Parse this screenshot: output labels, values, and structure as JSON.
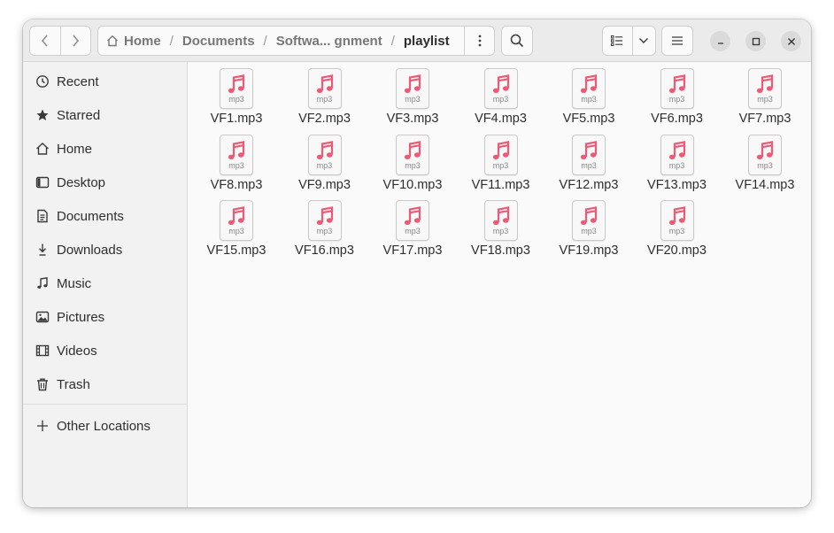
{
  "window": {
    "title": "playlist"
  },
  "headerbar": {
    "back_icon": "chevron-left-icon",
    "forward_icon": "chevron-right-icon",
    "path": [
      "Home",
      "Documents",
      "Softwa... gnment",
      "playlist"
    ],
    "path_separator": "/",
    "more_icon": "vertical-ellipsis-icon",
    "search_icon": "search-icon",
    "view_icon": "list-view-icon",
    "view_dropdown_icon": "chevron-down-icon",
    "menu_icon": "hamburger-icon",
    "minimize_icon": "minimize-icon",
    "maximize_icon": "maximize-icon",
    "close_icon": "close-icon"
  },
  "sidebar": {
    "items": [
      {
        "label": "Recent",
        "icon": "clock-icon"
      },
      {
        "label": "Starred",
        "icon": "star-icon"
      },
      {
        "label": "Home",
        "icon": "home-icon"
      },
      {
        "label": "Desktop",
        "icon": "desktop-icon"
      },
      {
        "label": "Documents",
        "icon": "document-icon"
      },
      {
        "label": "Downloads",
        "icon": "download-icon"
      },
      {
        "label": "Music",
        "icon": "music-note-icon"
      },
      {
        "label": "Pictures",
        "icon": "picture-icon"
      },
      {
        "label": "Videos",
        "icon": "film-icon"
      },
      {
        "label": "Trash",
        "icon": "trash-icon"
      }
    ],
    "other_locations": {
      "label": "Other Locations",
      "icon": "plus-icon"
    }
  },
  "files": [
    {
      "name": "VF1.mp3",
      "ext": "mp3"
    },
    {
      "name": "VF2.mp3",
      "ext": "mp3"
    },
    {
      "name": "VF3.mp3",
      "ext": "mp3"
    },
    {
      "name": "VF4.mp3",
      "ext": "mp3"
    },
    {
      "name": "VF5.mp3",
      "ext": "mp3"
    },
    {
      "name": "VF6.mp3",
      "ext": "mp3"
    },
    {
      "name": "VF7.mp3",
      "ext": "mp3"
    },
    {
      "name": "VF8.mp3",
      "ext": "mp3"
    },
    {
      "name": "VF9.mp3",
      "ext": "mp3"
    },
    {
      "name": "VF10.mp3",
      "ext": "mp3"
    },
    {
      "name": "VF11.mp3",
      "ext": "mp3"
    },
    {
      "name": "VF12.mp3",
      "ext": "mp3"
    },
    {
      "name": "VF13.mp3",
      "ext": "mp3"
    },
    {
      "name": "VF14.mp3",
      "ext": "mp3"
    },
    {
      "name": "VF15.mp3",
      "ext": "mp3"
    },
    {
      "name": "VF16.mp3",
      "ext": "mp3"
    },
    {
      "name": "VF17.mp3",
      "ext": "mp3"
    },
    {
      "name": "VF18.mp3",
      "ext": "mp3"
    },
    {
      "name": "VF19.mp3",
      "ext": "mp3"
    },
    {
      "name": "VF20.mp3",
      "ext": "mp3"
    }
  ],
  "colors": {
    "music_note": "#ee5a75",
    "accent": "#e95420"
  }
}
